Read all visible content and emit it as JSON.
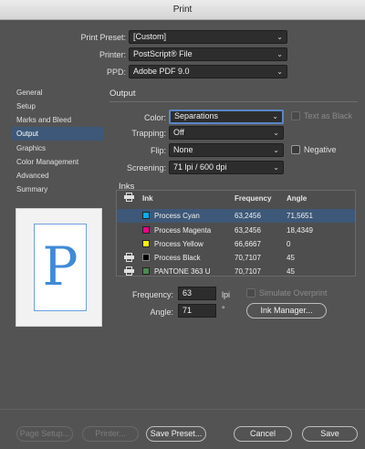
{
  "window": {
    "title": "Print"
  },
  "top": {
    "preset_label": "Print Preset:",
    "preset_value": "[Custom]",
    "printer_label": "Printer:",
    "printer_value": "PostScript® File",
    "ppd_label": "PPD:",
    "ppd_value": "Adobe PDF 9.0"
  },
  "sidebar": {
    "items": [
      {
        "label": "General"
      },
      {
        "label": "Setup"
      },
      {
        "label": "Marks and Bleed"
      },
      {
        "label": "Output",
        "active": true
      },
      {
        "label": "Graphics"
      },
      {
        "label": "Color Management"
      },
      {
        "label": "Advanced"
      },
      {
        "label": "Summary"
      }
    ]
  },
  "preview": {
    "letter": "P"
  },
  "output": {
    "title": "Output",
    "color_label": "Color:",
    "color_value": "Separations",
    "text_as_black_label": "Text as Black",
    "text_as_black_checked": false,
    "text_as_black_enabled": false,
    "trapping_label": "Trapping:",
    "trapping_value": "Off",
    "flip_label": "Flip:",
    "flip_value": "None",
    "negative_label": "Negative",
    "negative_checked": false,
    "screening_label": "Screening:",
    "screening_value": "71 lpi / 600 dpi"
  },
  "inks": {
    "title": "Inks",
    "columns": {
      "ink": "Ink",
      "frequency": "Frequency",
      "angle": "Angle"
    },
    "rows": [
      {
        "name": "Process Cyan",
        "frequency": "63,2456",
        "angle": "71,5651",
        "color": "#00aeef",
        "print_icon": false,
        "selected": true
      },
      {
        "name": "Process Magenta",
        "frequency": "63,2456",
        "angle": "18,4349",
        "color": "#ec008c",
        "print_icon": false,
        "selected": false
      },
      {
        "name": "Process Yellow",
        "frequency": "66,6667",
        "angle": "0",
        "color": "#fff200",
        "print_icon": false,
        "selected": false
      },
      {
        "name": "Process Black",
        "frequency": "70,7107",
        "angle": "45",
        "color": "#000000",
        "print_icon": true,
        "selected": false
      },
      {
        "name": "PANTONE 363 U",
        "frequency": "70,7107",
        "angle": "45",
        "color": "#4d8a4f",
        "print_icon": true,
        "selected": false
      }
    ],
    "frequency_label": "Frequency:",
    "frequency_value": "63",
    "frequency_unit": "lpi",
    "angle_label": "Angle:",
    "angle_value": "71",
    "angle_unit": "°",
    "simulate_overprint_label": "Simulate Overprint",
    "ink_manager_label": "Ink Manager..."
  },
  "buttons": {
    "page_setup": "Page Setup...",
    "printer": "Printer...",
    "save_preset": "Save Preset...",
    "cancel": "Cancel",
    "save": "Save"
  }
}
